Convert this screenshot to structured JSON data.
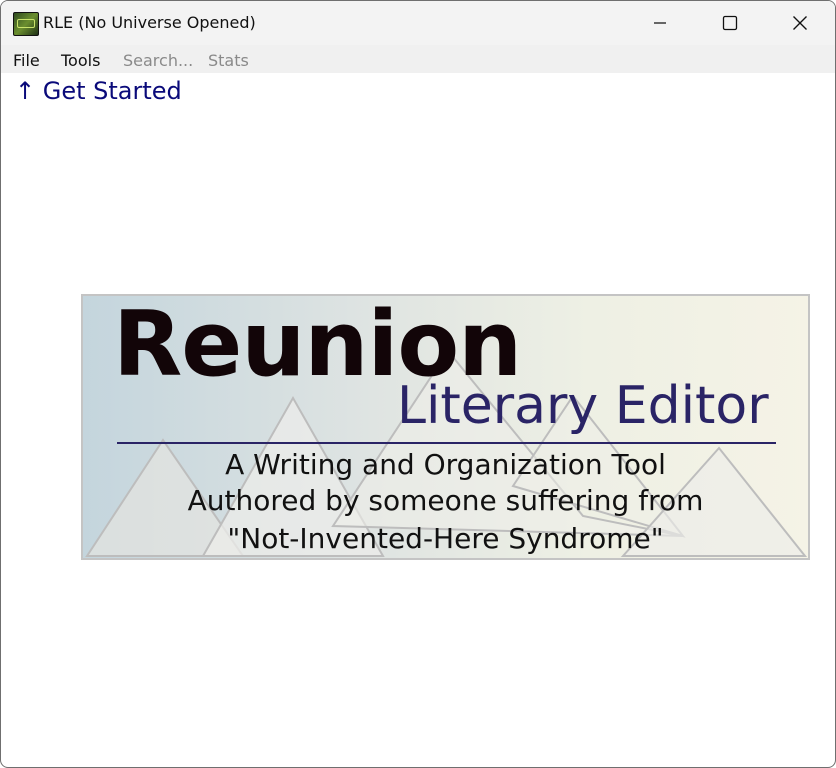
{
  "window": {
    "title": "RLE (No Universe Opened)",
    "icon": "rle-app-icon"
  },
  "titlebar_buttons": {
    "minimize_icon": "minimize-icon",
    "maximize_icon": "maximize-icon",
    "close_icon": "close-icon"
  },
  "menu": {
    "file": "File",
    "tools": "Tools",
    "search": "Search...",
    "stats": "Stats"
  },
  "main": {
    "get_started": "↑ Get Started"
  },
  "banner": {
    "title": "Reunion",
    "subtitle": "Literary Editor",
    "line1": "A Writing and Organization Tool",
    "line2": "Authored by someone suffering from",
    "line3": "\"Not-Invented-Here Syndrome\""
  },
  "colors": {
    "link": "#0a0a7a",
    "subtitle": "#2a2466",
    "disabled_menu": "#8a8a8a"
  }
}
